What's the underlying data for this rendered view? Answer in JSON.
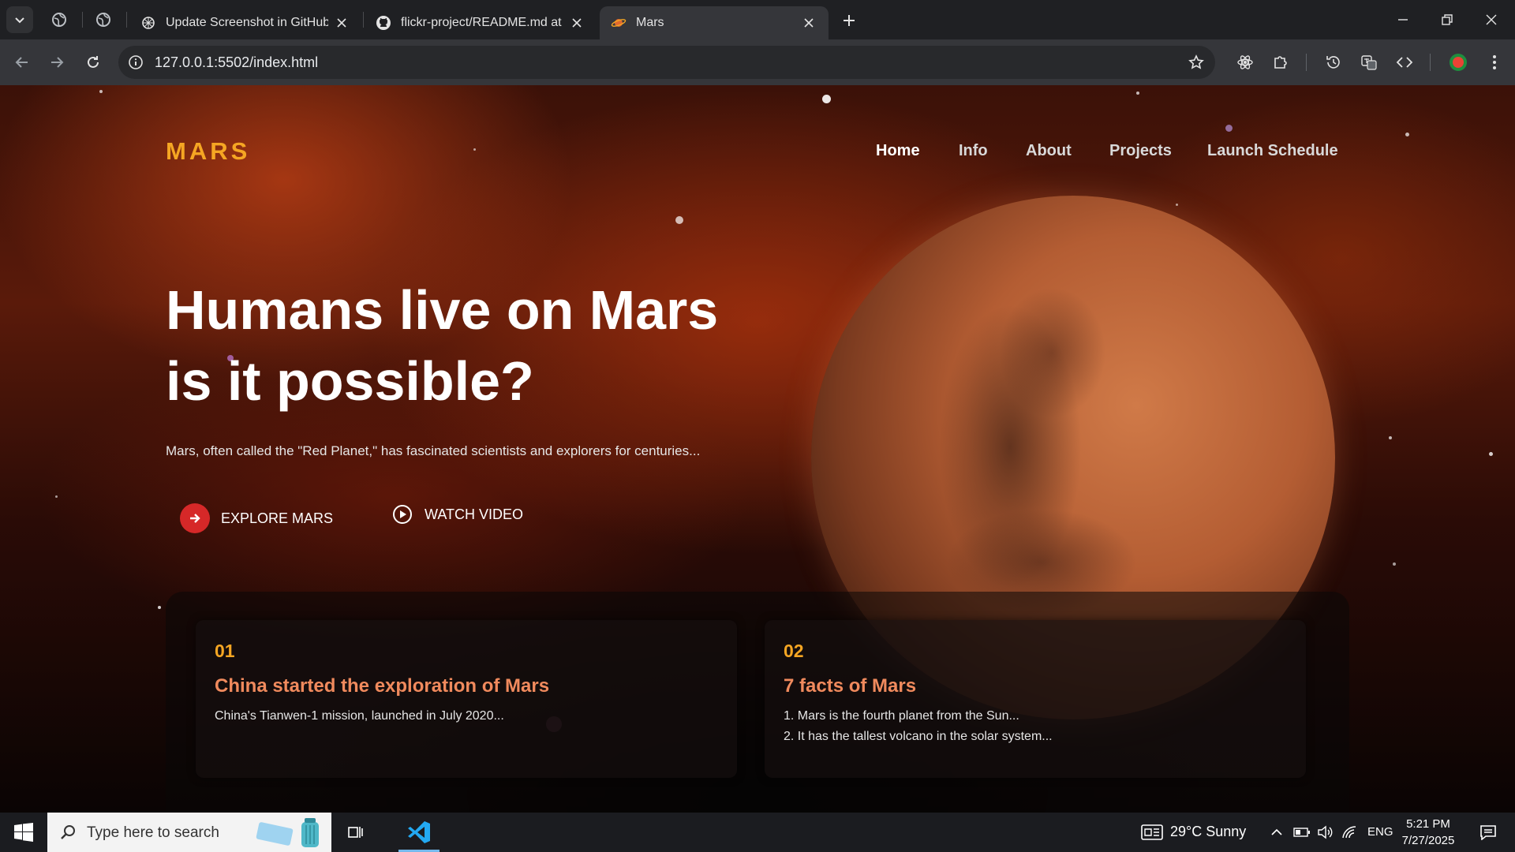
{
  "browser": {
    "tabs": [
      {
        "title": "Update Screenshot in GitHub",
        "active": false
      },
      {
        "title": "flickr-project/README.md at m",
        "active": false
      },
      {
        "title": "Mars",
        "active": true
      }
    ],
    "url": "127.0.0.1:5502/index.html"
  },
  "page": {
    "logo": "MARS",
    "nav": [
      "Home",
      "Info",
      "About",
      "Projects",
      "Launch Schedule"
    ],
    "hero": {
      "title_line1": "Humans live on Mars",
      "title_line2": "is it possible?",
      "subtitle": "Mars, often called the \"Red Planet,\" has fascinated scientists and explorers for centuries...",
      "explore_label": "EXPLORE MARS",
      "video_label": "WATCH VIDEO"
    },
    "cards": [
      {
        "num": "01",
        "title": "China started the exploration of Mars",
        "lines": [
          "China's Tianwen-1 mission, launched in July 2020..."
        ]
      },
      {
        "num": "02",
        "title": "7 facts of Mars",
        "lines": [
          "1. Mars is the fourth planet from the Sun...",
          "2. It has the tallest volcano in the solar system..."
        ]
      }
    ],
    "colors": {
      "accent": "#f5a623",
      "card_title": "#f08a5d",
      "cta": "#d62828"
    }
  },
  "taskbar": {
    "search_placeholder": "Type here to search",
    "weather": "29°C  Sunny",
    "language": "ENG",
    "time": "5:21 PM",
    "date": "7/27/2025"
  }
}
